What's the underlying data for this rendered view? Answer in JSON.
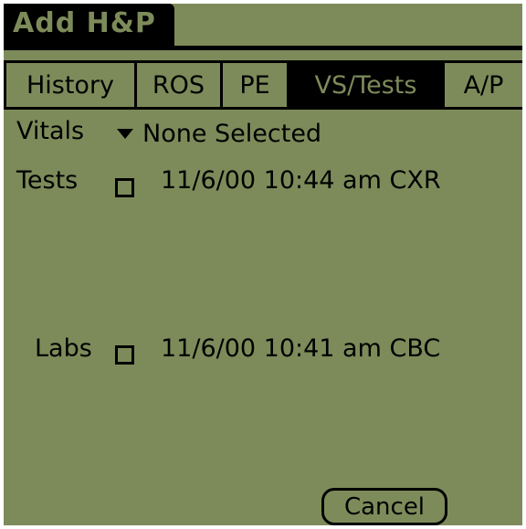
{
  "app": {
    "title": "Add H&P"
  },
  "tabs": [
    {
      "label": "History",
      "selected": false
    },
    {
      "label": "ROS",
      "selected": false
    },
    {
      "label": "PE",
      "selected": false
    },
    {
      "label": "VS/Tests",
      "selected": true
    },
    {
      "label": "A/P",
      "selected": false
    }
  ],
  "vitals": {
    "label": "Vitals",
    "value": "None Selected",
    "icon": "dropdown-triangle-icon"
  },
  "tests": {
    "label": "Tests",
    "items": [
      {
        "text": "11/6/00 10:44 am CXR",
        "checked": false
      }
    ]
  },
  "labs": {
    "label": "Labs",
    "items": [
      {
        "text": "11/6/00 10:41 am CBC",
        "checked": false
      }
    ]
  },
  "buttons": {
    "cancel": "Cancel"
  },
  "colors": {
    "screen_background": "#7d8b5a",
    "ink": "#000000"
  }
}
